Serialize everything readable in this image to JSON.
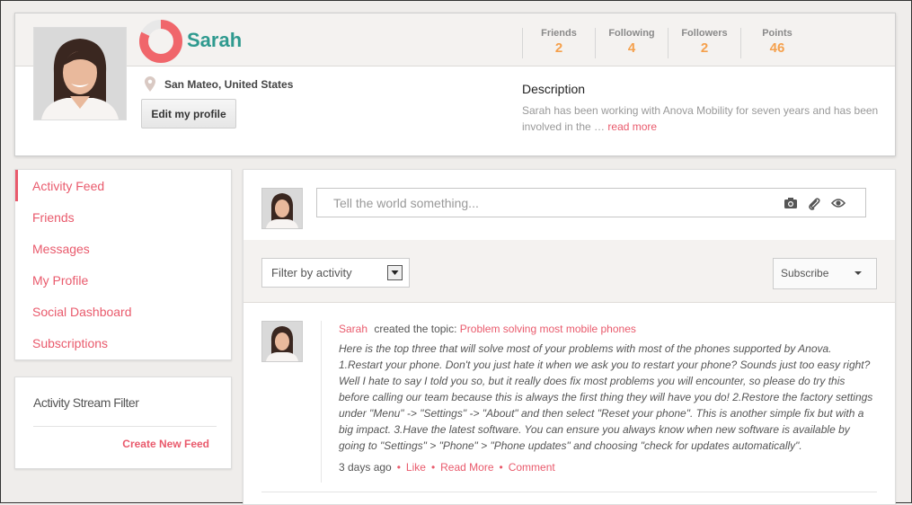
{
  "profile": {
    "name": "Sarah",
    "location": "San Mateo, United States",
    "edit_label": "Edit my profile",
    "stats": [
      {
        "label": "Friends",
        "value": "2"
      },
      {
        "label": "Following",
        "value": "4"
      },
      {
        "label": "Followers",
        "value": "2"
      },
      {
        "label": "Points",
        "value": "46"
      }
    ],
    "description_title": "Description",
    "description_text": "Sarah has been working with Anova Mobility for seven years and has been involved in the …",
    "read_more": "read more",
    "progress_fraction": 0.82,
    "colors": {
      "accent": "#e95a6c",
      "name": "#2f9a8f",
      "stats": "#f5a04c"
    }
  },
  "nav": {
    "items": [
      {
        "label": "Activity Feed",
        "active": true
      },
      {
        "label": "Friends"
      },
      {
        "label": "Messages"
      },
      {
        "label": "My Profile"
      },
      {
        "label": "Social Dashboard"
      },
      {
        "label": "Subscriptions"
      }
    ]
  },
  "stream_filter": {
    "title": "Activity Stream Filter",
    "create": "Create New Feed"
  },
  "composer": {
    "placeholder": "Tell the world something...",
    "icons": [
      "camera-icon",
      "paperclip-icon",
      "eye-icon"
    ]
  },
  "toolbar": {
    "filter_label": "Filter by activity",
    "subscribe_label": "Subscribe"
  },
  "feed": {
    "author": "Sarah",
    "action": "created the topic:",
    "topic": "Problem solving most mobile phones",
    "body": "Here is the top three that will solve most of your problems with most of the phones supported by Anova. 1.Restart your phone. Don't you just hate it when we ask you to restart your phone? Sounds just too easy right? Well I hate to say I told you so, but it really does fix most problems you will encounter, so please do try this before calling our team because this is always the first thing they will have you do! 2.Restore the factory settings under \"Menu\" -> \"Settings\" -> \"About\" and then select \"Reset your phone\". This is another simple fix but with a big impact. 3.Have the latest software. You can ensure you always know when new software is available by going to \"Settings\" > \"Phone\" > \"Phone updates\" and choosing \"check for updates automatically\".",
    "time": "3 days ago",
    "like": "Like",
    "read_more": "Read More",
    "comment": "Comment"
  }
}
